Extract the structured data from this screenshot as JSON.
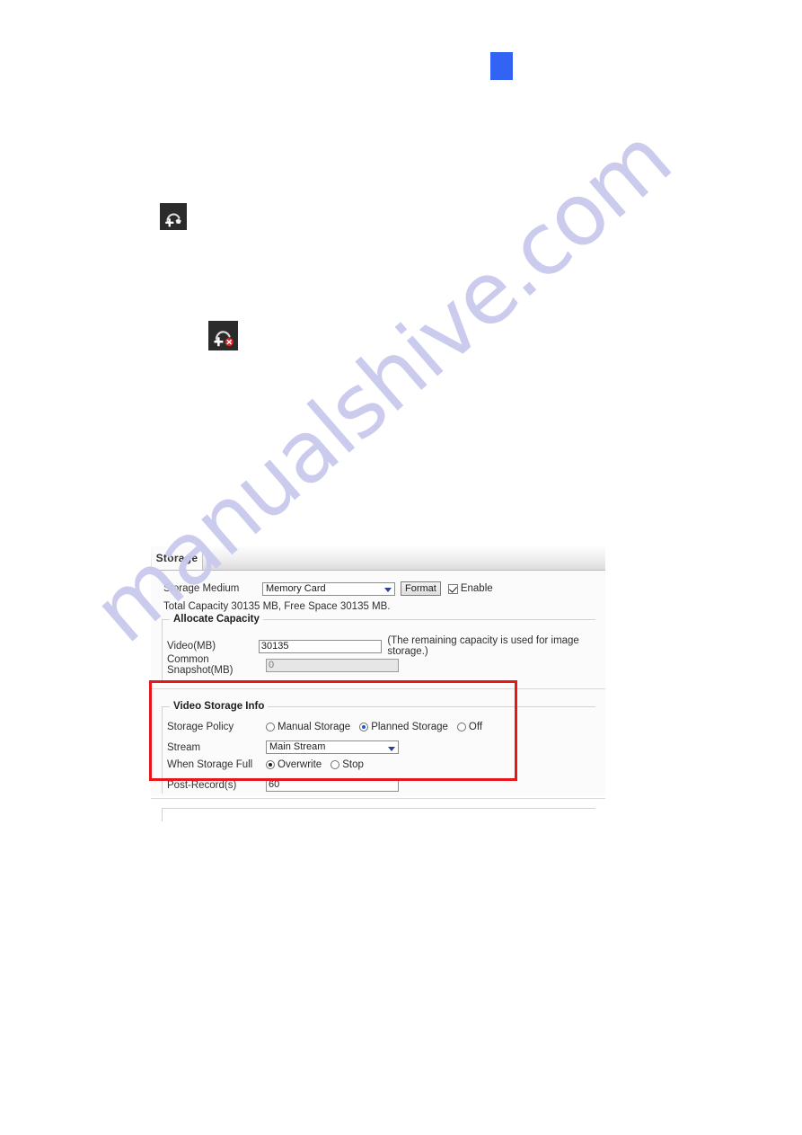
{
  "page": {
    "accent_blue": "#3363f4",
    "highlight_red": "#e8151b",
    "watermark_text": "manualshive.com",
    "watermark_color": "#c9c9ee"
  },
  "icons": {
    "add_preset": "add-preset-icon",
    "delete_preset": "delete-preset-icon",
    "blue_marker": "blue-square-marker"
  },
  "storage_panel": {
    "tabs": [
      {
        "label": "Storage",
        "active": true
      }
    ],
    "storage_medium": {
      "label": "Storage Medium",
      "value": "Memory Card",
      "format_button": "Format",
      "enable_label": "Enable",
      "enable_checked": true
    },
    "capacity_text": "Total Capacity 30135 MB, Free Space 30135 MB.",
    "allocate_capacity": {
      "legend": "Allocate Capacity",
      "video_label": "Video(MB)",
      "video_value": "30135",
      "video_hint": "(The remaining capacity is used for image storage.)",
      "snapshot_label": "Common Snapshot(MB)",
      "snapshot_value": "0",
      "snapshot_disabled": true
    },
    "video_storage_info": {
      "legend": "Video Storage Info",
      "storage_policy": {
        "label": "Storage Policy",
        "options": [
          {
            "label": "Manual Storage",
            "selected": false
          },
          {
            "label": "Planned Storage",
            "selected": true
          },
          {
            "label": "Off",
            "selected": false
          }
        ]
      },
      "stream": {
        "label": "Stream",
        "value": "Main Stream"
      },
      "when_storage_full": {
        "label": "When Storage Full",
        "options": [
          {
            "label": "Overwrite",
            "selected": true
          },
          {
            "label": "Stop",
            "selected": false
          }
        ]
      },
      "post_record": {
        "label": "Post-Record(s)",
        "value": "60"
      }
    }
  }
}
